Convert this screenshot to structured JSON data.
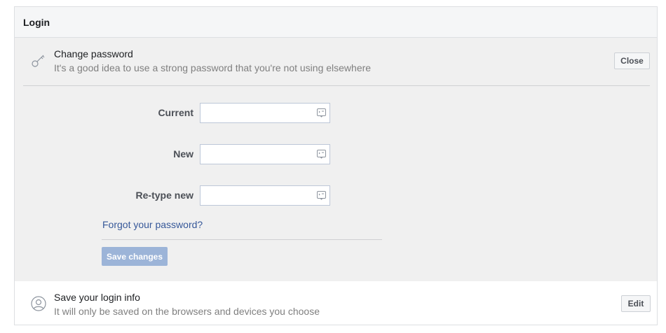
{
  "header": {
    "title": "Login"
  },
  "change_password": {
    "title": "Change password",
    "subtitle": "It's a good idea to use a strong password that you're not using elsewhere",
    "close_label": "Close",
    "icon": "key-icon",
    "fields": [
      {
        "label": "Current",
        "value": "",
        "icon": "password-manager-icon"
      },
      {
        "label": "New",
        "value": "",
        "icon": "password-manager-icon"
      },
      {
        "label": "Re-type new",
        "value": "",
        "icon": "password-manager-icon"
      }
    ],
    "forgot_link": "Forgot your password?",
    "save_label": "Save changes"
  },
  "login_info": {
    "title": "Save your login info",
    "subtitle": "It will only be saved on the browsers and devices you choose",
    "edit_label": "Edit",
    "icon": "person-icon"
  },
  "colors": {
    "link": "#365899",
    "save_button_disabled": "#9cb4d8",
    "section_bg": "#f0f0f0",
    "header_bg": "#f5f6f7"
  }
}
